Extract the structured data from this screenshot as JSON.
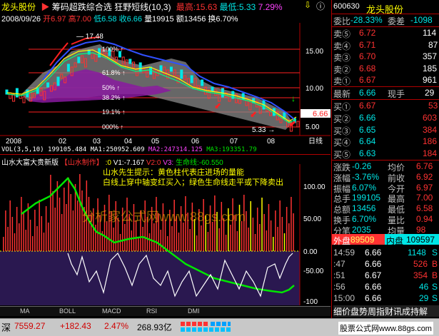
{
  "header": {
    "stock_name": "龙头股份",
    "indicator_title": "筹码超跌综合选",
    "indicator2": "狂野短线",
    "params": "(10,3)",
    "high_label": "最高:15.63",
    "low_label": "最低:5.33",
    "pct": "7.29%",
    "date": "2008/09/26",
    "open": "开6.97",
    "high": "高7.00",
    "low": "低6.58",
    "close": "收6.66",
    "vol": "量19915",
    "amount": "额13456",
    "turnover": "换6.70%"
  },
  "main_chart": {
    "peak_label": "17.48",
    "low_label": "5.33",
    "current_price": "6.66",
    "pct_labels": [
      "100%",
      "61.8%",
      "50%",
      "38.2%",
      "19.1%",
      "000%"
    ],
    "y_ticks": [
      "15.00",
      "10.00",
      "5.00"
    ],
    "x_ticks": [
      "2008",
      "02",
      "03",
      "04",
      "05",
      "06",
      "07",
      "08",
      "09"
    ],
    "period": "日线"
  },
  "vol_line": {
    "label": "VOL(3,5,10)",
    "v": "199105.484",
    "ma1": "MA1:250952.609",
    "ma2": "MA2:247314.125",
    "ma3": "MA3:193351.79"
  },
  "ind": {
    "title": "山水大富大贵新版",
    "author": "【山水制作】",
    "v0": ":0",
    "v1": "V1:-7.167",
    "v2": "V2:0",
    "v3": "V3:",
    "life": "生命线:-60.550",
    "tip1": "山水先生提示：黄色柱代表庄进场的量能",
    "tip2": "白线上穿中轴变红买入；绿色生命线走平或下降卖出",
    "y_ticks": [
      "100.00",
      "50.00",
      "0.00",
      "-50.00",
      "-100"
    ],
    "watermark": "分析家公式网www.88gs.com"
  },
  "tabs": [
    "MA",
    "BOLL",
    "MACD",
    "RSI",
    "DMI"
  ],
  "status": {
    "market": "深",
    "index": "7559.27",
    "change": "+182.43",
    "pct": "2.47%",
    "amount": "268.93亿",
    "brand": "股票公式网www.88gs.com"
  },
  "quote": {
    "code": "600630",
    "name": "龙头股份",
    "wei_bi_label": "委比",
    "wei_bi": "-28.33%",
    "wei_cha_label": "委差",
    "wei_cha": "-1098",
    "sells": [
      {
        "label": "卖⑤",
        "price": "6.72",
        "vol": "114"
      },
      {
        "label": "卖④",
        "price": "6.71",
        "vol": "87"
      },
      {
        "label": "卖③",
        "price": "6.70",
        "vol": "357"
      },
      {
        "label": "卖②",
        "price": "6.68",
        "vol": "185"
      },
      {
        "label": "卖①",
        "price": "6.67",
        "vol": "961"
      }
    ],
    "last_label": "最新",
    "last": "6.66",
    "hand_label": "现手",
    "hand": "29",
    "buys": [
      {
        "label": "买①",
        "price": "6.67",
        "vol": "53"
      },
      {
        "label": "买②",
        "price": "6.66",
        "vol": "603"
      },
      {
        "label": "买③",
        "price": "6.65",
        "vol": "384"
      },
      {
        "label": "买④",
        "price": "6.64",
        "vol": "186"
      },
      {
        "label": "买⑤",
        "price": "6.63",
        "vol": "184"
      }
    ],
    "stats": [
      [
        "涨跌",
        "-0.26",
        "均价",
        "6.76"
      ],
      [
        "涨幅",
        "-3.76%",
        "前收",
        "6.92"
      ],
      [
        "振幅",
        "6.07%",
        "今开",
        "6.97"
      ],
      [
        "总手",
        "199105",
        "最高",
        "7.00"
      ],
      [
        "总额",
        "13456",
        "最低",
        "6.58"
      ],
      [
        "换手",
        "6.70%",
        "量比",
        "0.94"
      ],
      [
        "分笔",
        "2035",
        "均量",
        "98"
      ]
    ],
    "outer_label": "外盘",
    "outer": "89509",
    "inner_label": "内盘",
    "inner": "109597",
    "ticks": [
      {
        "t": "14:59",
        "p": "6.66",
        "v": "1148",
        "s": "S"
      },
      {
        "t": ":47",
        "p": "6.66",
        "v": "526",
        "s": "B"
      },
      {
        "t": ":51",
        "p": "6.67",
        "v": "354",
        "s": "B"
      },
      {
        "t": ":56",
        "p": "6.66",
        "v": "46",
        "s": "S"
      },
      {
        "t": "15:00",
        "p": "6.66",
        "v": "29",
        "s": "S"
      }
    ],
    "bottom_tabs": "细价盘势周指财讯成持解"
  },
  "colors": {
    "up": "#ff3232",
    "down": "#00e6e6",
    "axis": "#b00000",
    "yellow": "#ffff00"
  }
}
